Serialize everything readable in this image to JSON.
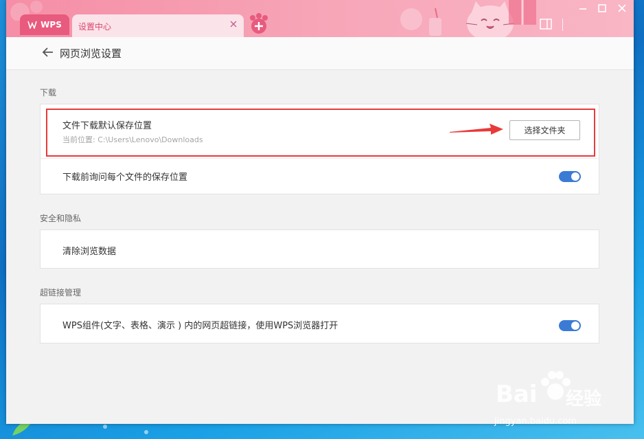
{
  "tabs": {
    "wps_label": "WPS",
    "settings_label": "设置中心"
  },
  "header": {
    "title": "网页浏览设置"
  },
  "sections": {
    "download": {
      "title": "下载",
      "save_location_label": "文件下载默认保存位置",
      "current_location": "当前位置: C:\\Users\\Lenovo\\Downloads",
      "choose_folder_button": "选择文件夹",
      "ask_before_download_label": "下载前询问每个文件的保存位置",
      "ask_before_download_on": true
    },
    "privacy": {
      "title": "安全和隐私",
      "clear_data_label": "清除浏览数据"
    },
    "hyperlink": {
      "title": "超链接管理",
      "open_in_wps_label": "WPS组件(文字、表格、演示 ) 内的网页超链接，使用WPS浏览器打开",
      "open_in_wps_on": true
    }
  },
  "watermark": {
    "brand": "Bai",
    "brand_suffix": "经验",
    "url": "jingyan.baidu.com"
  },
  "colors": {
    "titlebar": "#f58ea6",
    "wps_tab": "#e85a7e",
    "toggle_on": "#3a7bd5",
    "highlight": "#e83a3a"
  }
}
